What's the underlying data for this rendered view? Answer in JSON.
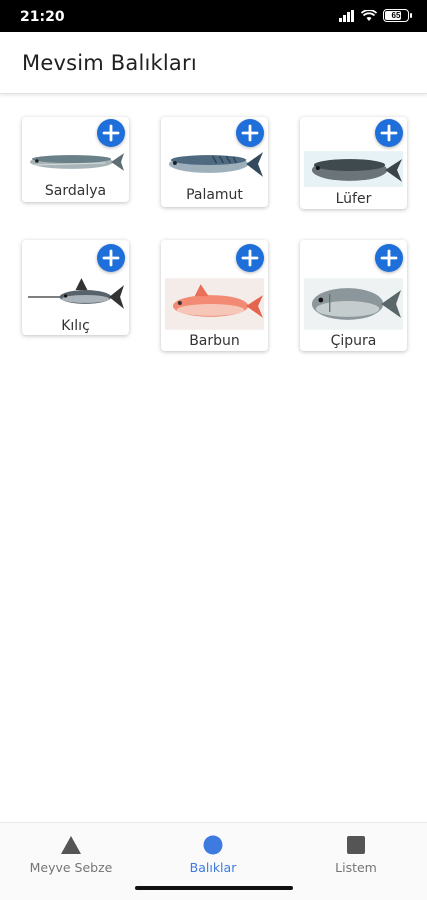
{
  "status_bar": {
    "time": "21:20",
    "battery": "65"
  },
  "app_bar": {
    "title": "Mevsim Balıkları"
  },
  "fish": [
    {
      "name": "Sardalya",
      "icon": "sardine-image"
    },
    {
      "name": "Palamut",
      "icon": "bonito-image"
    },
    {
      "name": "Lüfer",
      "icon": "bluefish-image"
    },
    {
      "name": "Kılıç",
      "icon": "swordfish-image"
    },
    {
      "name": "Barbun",
      "icon": "red-mullet-image"
    },
    {
      "name": "Çipura",
      "icon": "sea-bream-image"
    }
  ],
  "bottom_nav": {
    "items": [
      {
        "label": "Meyve Sebze",
        "icon": "triangle-icon"
      },
      {
        "label": "Balıklar",
        "icon": "circle-icon",
        "active": true
      },
      {
        "label": "Listem",
        "icon": "square-icon"
      }
    ]
  },
  "colors": {
    "accent": "#1e6fd9",
    "active_nav": "#3d7be0",
    "inactive_nav": "#757575"
  }
}
